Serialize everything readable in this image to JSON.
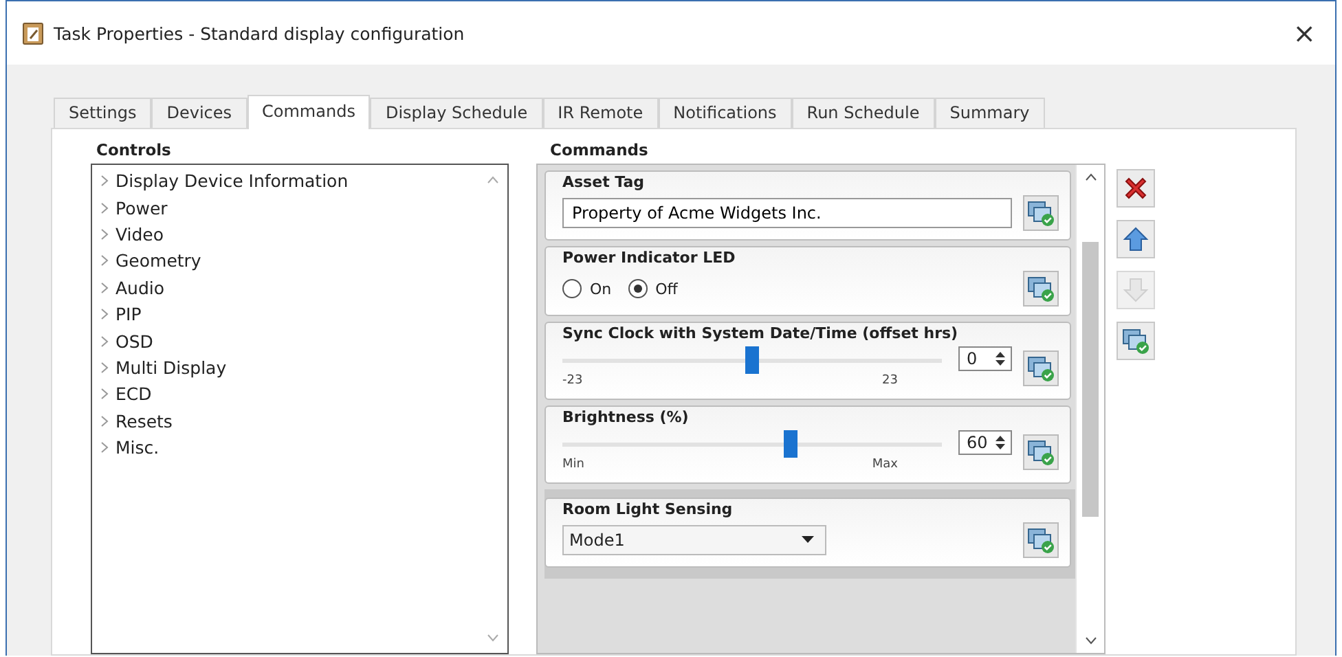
{
  "window": {
    "title": "Task Properties - Standard display configuration",
    "close": "×"
  },
  "tabs": [
    {
      "label": "Settings",
      "selected": false
    },
    {
      "label": "Devices",
      "selected": false
    },
    {
      "label": "Commands",
      "selected": true
    },
    {
      "label": "Display Schedule",
      "selected": false
    },
    {
      "label": "IR Remote",
      "selected": false
    },
    {
      "label": "Notifications",
      "selected": false
    },
    {
      "label": "Run Schedule",
      "selected": false
    },
    {
      "label": "Summary",
      "selected": false
    }
  ],
  "controls": {
    "title": "Controls",
    "items": [
      {
        "label": "Display Device Information"
      },
      {
        "label": "Power"
      },
      {
        "label": "Video"
      },
      {
        "label": "Geometry"
      },
      {
        "label": "Audio"
      },
      {
        "label": "PIP"
      },
      {
        "label": "OSD"
      },
      {
        "label": "Multi Display"
      },
      {
        "label": "ECD"
      },
      {
        "label": "Resets"
      },
      {
        "label": "Misc."
      }
    ]
  },
  "commands": {
    "title": "Commands",
    "items": [
      {
        "kind": "text",
        "title": "Asset Tag",
        "value": "Property of Acme Widgets Inc.",
        "selected": false
      },
      {
        "kind": "radio",
        "title": "Power Indicator LED",
        "options": [
          {
            "label": "On",
            "selected": false
          },
          {
            "label": "Off",
            "selected": true
          }
        ],
        "selected": false
      },
      {
        "kind": "slider",
        "title": "Sync Clock with System Date/Time (offset hrs)",
        "level": 0.5,
        "min": "-23",
        "max": "23",
        "value": "0",
        "selected": false
      },
      {
        "kind": "slider",
        "title": "Brightness (%)",
        "level": 0.6,
        "min": "Min",
        "max": "Max",
        "value": "60",
        "selected": false
      },
      {
        "kind": "dropdown",
        "title": "Room Light Sensing",
        "value": "Mode1",
        "selected": true
      }
    ],
    "side_buttons": [
      {
        "kind": "delete",
        "disabled": false
      },
      {
        "kind": "up",
        "disabled": false
      },
      {
        "kind": "down",
        "disabled": true
      },
      {
        "kind": "apply",
        "disabled": false
      }
    ]
  }
}
